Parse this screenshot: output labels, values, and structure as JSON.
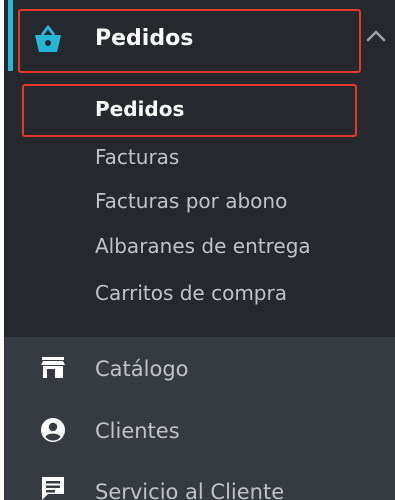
{
  "sidebar": {
    "active_menu": {
      "label": "Pedidos",
      "icon": "basket-icon",
      "expand_icon": "chevron-up-icon",
      "submenu": [
        {
          "label": "Pedidos",
          "active": true
        },
        {
          "label": "Facturas",
          "active": false
        },
        {
          "label": "Facturas por abono",
          "active": false
        },
        {
          "label": "Albaranes de entrega",
          "active": false
        },
        {
          "label": "Carritos de compra",
          "active": false
        }
      ]
    },
    "menu_items": [
      {
        "label": "Catálogo",
        "icon": "store-icon"
      },
      {
        "label": "Clientes",
        "icon": "account-circle-icon"
      },
      {
        "label": "Servicio al Cliente",
        "icon": "chat-message-icon"
      }
    ]
  },
  "colors": {
    "active_background": "#25292d",
    "sidebar_background": "#363a41",
    "accent": "#25b9d7",
    "highlight_outline": "#e3382b",
    "text_primary": "#ffffff",
    "text_secondary": "#bfc3c8"
  }
}
